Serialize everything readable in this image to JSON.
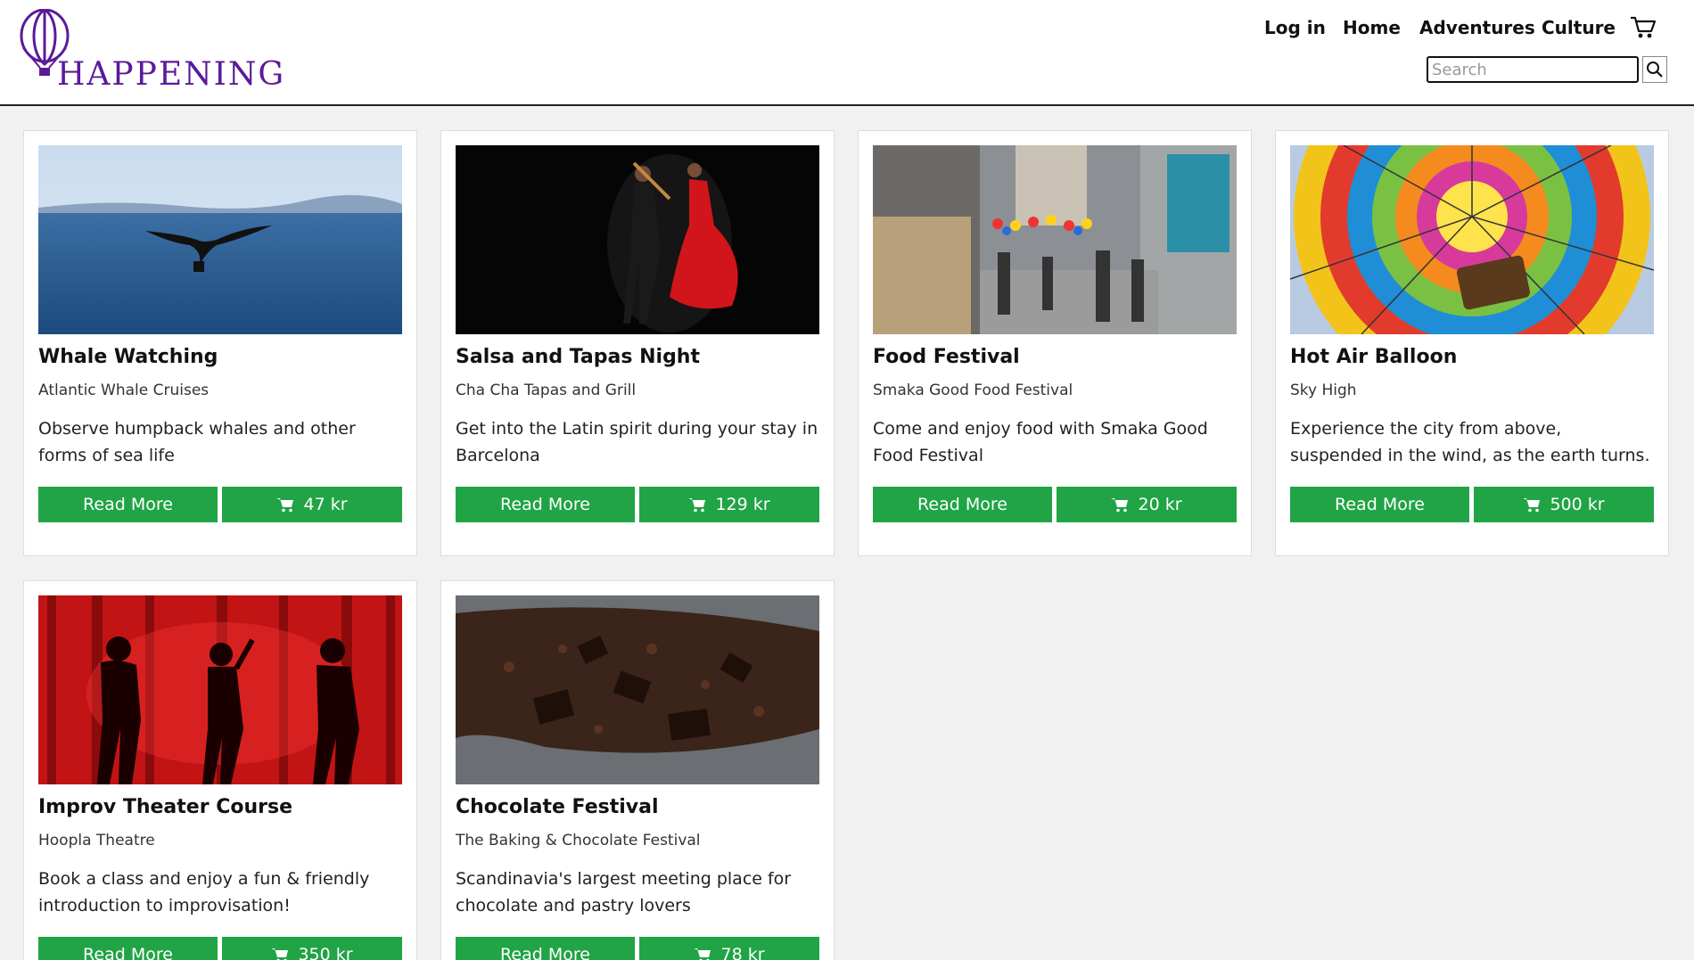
{
  "brand": {
    "name": "HAPPENING",
    "color": "#5b1a99"
  },
  "nav": {
    "login": "Log in",
    "home": "Home",
    "adventures": "Adventures",
    "culture": "Culture"
  },
  "search": {
    "placeholder": "Search",
    "value": ""
  },
  "colors": {
    "button": "#20a445",
    "page_bg": "#f1f1f1"
  },
  "cards": [
    {
      "title": "Whale Watching",
      "organizer": "Atlantic Whale Cruises",
      "description": "Observe humpback whales and other forms of sea life",
      "read_more": "Read More",
      "price": "47 kr",
      "image": "whale-tail-ocean"
    },
    {
      "title": "Salsa and Tapas Night",
      "organizer": "Cha Cha Tapas and Grill",
      "description": "Get into the Latin spirit during your stay in Barcelona",
      "read_more": "Read More",
      "price": "129 kr",
      "image": "salsa-dancers"
    },
    {
      "title": "Food Festival",
      "organizer": "Smaka Good Food Festival",
      "description": "Come and enjoy food with Smaka Good Food Festival",
      "read_more": "Read More",
      "price": "20 kr",
      "image": "street-food-market"
    },
    {
      "title": "Hot Air Balloon",
      "organizer": "Sky High",
      "description": "Experience the city from above, suspended in the wind, as the earth turns.",
      "read_more": "Read More",
      "price": "500 kr",
      "image": "hot-air-balloon"
    },
    {
      "title": "Improv Theater Course",
      "organizer": "Hoopla Theatre",
      "description": "Book a class and enjoy a fun & friendly introduction to improvisation!",
      "read_more": "Read More",
      "price": "350 kr",
      "image": "theater-silhouettes"
    },
    {
      "title": "Chocolate Festival",
      "organizer": "The Baking & Chocolate Festival",
      "description": "Scandinavia's largest meeting place for chocolate and pastry lovers",
      "read_more": "Read More",
      "price": "78 kr",
      "image": "chocolate-pieces"
    }
  ]
}
